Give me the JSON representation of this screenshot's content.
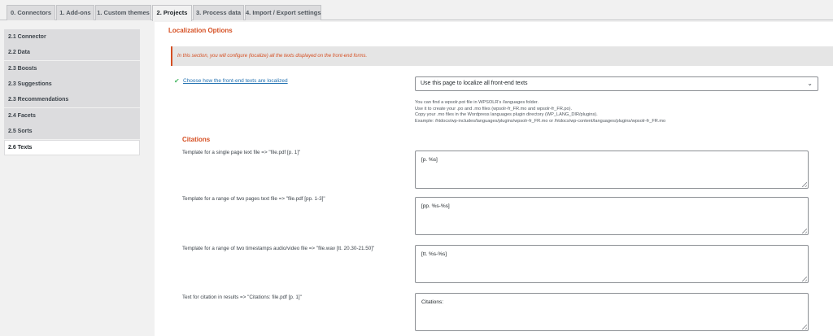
{
  "tabs": [
    {
      "label": "0. Connectors"
    },
    {
      "label": "1. Add-ons"
    },
    {
      "label": "1. Custom themes"
    },
    {
      "label": "2. Projects"
    },
    {
      "label": "3. Process data"
    },
    {
      "label": "4. Import / Export settings"
    }
  ],
  "sidebar": {
    "items": [
      {
        "label": "2.1 Connector"
      },
      {
        "label": "2.2 Data"
      },
      {
        "label": "2.3 Boosts"
      },
      {
        "label": "2.3 Suggestions"
      },
      {
        "label": "2.3 Recommendations"
      },
      {
        "label": "2.4 Facets"
      },
      {
        "label": "2.5 Sorts"
      },
      {
        "label": "2.6 Texts"
      }
    ]
  },
  "main": {
    "section_title": "Localization Options",
    "notice": "In this section, you will configure (localize) all the texts displayed on the front-end forms.",
    "localize_link": "Choose how the front-end texts are localized",
    "localize_select": "Use this page to localize all front-end texts",
    "help_lines": [
      "You can find a wpsolr.pot file in WPSOLR's /languages folder.",
      "Use it to create your .po and .mo files (wpsolr-fr_FR.mo and wpsolr-fr_FR.po).",
      "Copy your .mo files in the Wordpress languages plugin directory (WP_LANG_DIR/plugins).",
      "Example: /htdocs/wp-includes/languages/plugins/wpsolr-fr_FR.mo or /htdocs/wp-content/languages/plugins/wpsolr-fr_FR.mo"
    ],
    "citations_title": "Citations",
    "fields": [
      {
        "label": "Template for a single page text file => \"file.pdf [p. 1]\"",
        "value": "[p. %s]"
      },
      {
        "label": "Template for a range of two pages text file => \"file.pdf [pp. 1-3]\"",
        "value": "[pp. %s-%s]"
      },
      {
        "label": "Template for a range of two timestamps audio/video file => \"file.wav [tt. 20.30-21.50]\"",
        "value": "[tt. %s-%s]"
      },
      {
        "label": "Text for citation in results => \"Citations: file.pdf [p. 1]\"",
        "value": "Citations:"
      }
    ]
  },
  "colors": {
    "accent": "#d54e21",
    "link": "#2271b1",
    "check": "#4ab866"
  }
}
